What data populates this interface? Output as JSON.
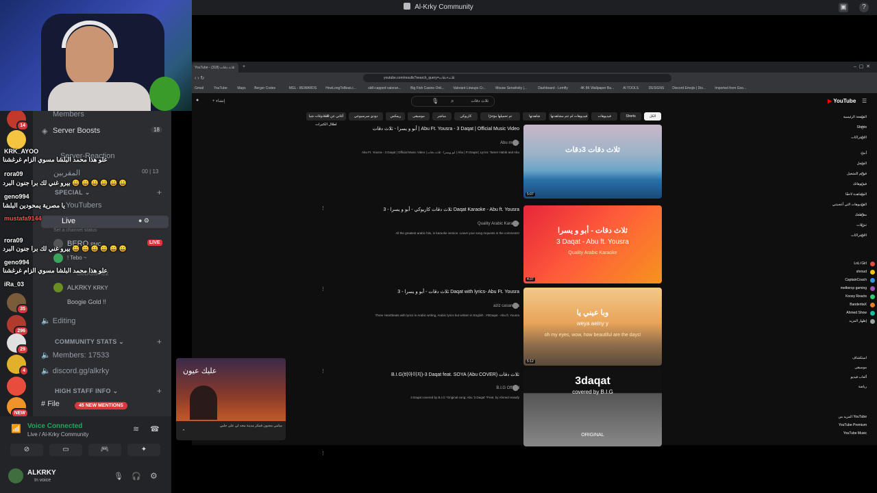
{
  "app": {
    "title": "Al-Krky Community"
  },
  "rail": {
    "servers": [
      {
        "badge": "14",
        "color": "#c0392b"
      },
      {
        "badge": "",
        "color": "#f5c542"
      },
      {
        "badge": "35",
        "color": "#7a5c3a"
      },
      {
        "badge": "296",
        "color": "#b03a2e"
      },
      {
        "badge": "29",
        "color": "#e0e0e0"
      },
      {
        "badge": "4",
        "color": "#e1b12c"
      },
      {
        "badge": "",
        "color": "#e74c3c"
      },
      {
        "badge": "NEW",
        "color": "#f0932b"
      }
    ]
  },
  "sidebar": {
    "members": "Members",
    "server_boosts": "Server Boosts",
    "boost_count": "18",
    "server_reaction": "Server-Reaction",
    "category_muted_label": "المقربين",
    "muted_count_a": "00",
    "muted_count_b": "13",
    "special_category": "SPECIAL",
    "youtubers": "YouTubers",
    "live_channel": "Live",
    "channel_status_placeholder": "Set a channel status",
    "voice_user_1": "BERO",
    "voice_user_1_tag": "PMC",
    "live_badge": "LIVE",
    "voice_user_2": "! Tebo ~",
    "voice_user_3": "SeDGamez",
    "voice_user_4": "ALKRKY",
    "voice_user_4_tag": "KRKY",
    "voice_user_5": "Boogie Gold !!",
    "editing": "Editing",
    "community_stats": "COMMUNITY STATS",
    "members_count": "Members: 17533",
    "invite": "discord.gg/alkrky",
    "high_staff": "HIGH STAFF INFO",
    "files": "File",
    "new_mentions": "45 NEW MENTIONS"
  },
  "chat_overlay": [
    {
      "user": "KRK_AYOO",
      "text": "علو هذا محمد البلشا مسوي الزام غرغشنا"
    },
    {
      "user": "rora09",
      "text": "بيرو غني لك برا جنون البرد 😀 😀 😀 😀 😀 😀"
    },
    {
      "user": "geno994",
      "text": "يا مصرية يمحودين البلشا"
    },
    {
      "user": "mustafa9144",
      "text": ""
    },
    {
      "user": "rora09",
      "text": "بيرو غني لك برا جنون البرد 😀 😀 😀 😀 😀 😀"
    },
    {
      "user": "geno994",
      "text": "علو هذا محمد البلشا مسوي الزام غرغشنا"
    },
    {
      "user": "iRa_03",
      "text": ""
    }
  ],
  "voice": {
    "status": "Voice Connected",
    "channel": "Live / Al-Krky Community"
  },
  "user": {
    "name": "ALKRKY",
    "status": "In voice"
  },
  "browser": {
    "tab_title": "YouTube - ثلاث دقات (318)",
    "url": "youtube.com/results?search_query=ثلاث+دقات",
    "bookmarks": [
      "Gmail",
      "YouTube",
      "Maps",
      "Berger Codes",
      "MGL - REWARDS",
      "HowLongToBeat.c...",
      "skill-capped valoran...",
      "Big Fish Casino Onli...",
      "Valorant Lineups Cr...",
      "Mouse Sensitivity |...",
      "Dashboard - Lemfly",
      "4K 8K Wallpaper Ba...",
      "AI TOOLS",
      "DESIGNS",
      "Discord Emojis | Dis...",
      "Imported from Goo..."
    ],
    "search_query": "ثلاث دقات",
    "chips": [
      "الكل",
      "Shorts",
      "فيديوهات",
      "فيديوهات لم تتم مشاهدتها",
      "شاهدتها",
      "تم تحميلها مؤخرًا",
      "كاريوكي",
      "مباشر",
      "موسيقى",
      "ريمكس",
      "دودي سرسيوعي",
      "أغاني عن ثلاث دقات شيا لطلال الكثيرات"
    ],
    "filter": "الفلاتر",
    "results": [
      {
        "title": "أبو و يسرا - ثلاث دقات | Abu Ft. Yousra - 3 Daqat | Official Music Video",
        "channel": "Abu music",
        "desc": "Abu Ft. Yousra - 3 Daqat | Official Music Video | أبو ويسرا - ثلاث دقات | Abu | Ft Daqat | Lyrics: Tamer Habib and Abu",
        "duration": "5:07",
        "thumb_text": "ثلاث دقات 3دقات"
      },
      {
        "title": "ثلاث دقات كاريوكي - أبو و يسرا - 3 Daqat Karaoke - Abu ft. Yousra",
        "channel": "Quality Arabic Karaoke",
        "desc": "All the greatest arabic hits, in karaoke version. Leave your song requests in the comments!",
        "duration": "4:37",
        "thumb_text": "ثلاث دقات - أبو و يسرا",
        "thumb_sub": "3 Daqat - Abu ft. Yousra",
        "thumb_sub2": "Quality Arabic Karaoke"
      },
      {
        "title": "ثلاث دقات - أبو و يسرا - 3 Daqat with lyrics- Abu Ft. Yousra",
        "channel": "aziz casanova",
        "desc": "Three Heartbeats with lyrics in Arabic writing, Arabic lyrics but written in English : #3Daqat - Abu ft. Yousra",
        "duration": "5:12",
        "thumb_text": "وبا عيني يا",
        "thumb_sub": "weya aeiny y",
        "thumb_sub2": "oh my eyes, wow, how beautiful are the days!"
      },
      {
        "title": "B.I.G(비아이지)-3 Daqat feat. SOYA (Abu COVER) ثلاث دقات",
        "channel": "B.I.G Official",
        "desc": "3 Daqat covered by B.I.G *Original song: Abu '3 Daqat' *Feat. by Ahmed Hasafy",
        "duration": "",
        "thumb_text": "3daqat",
        "thumb_sub": "covered by B.I.G",
        "thumb_sub2": "ORIGINAL"
      }
    ],
    "yt_logo": "YouTube",
    "side_nav": [
      "الصفحة الرئيسية",
      "Shorts",
      "الاشتراكات",
      "أنت",
      "السجل",
      "قوائم التشغيل",
      "فيديوهاتك",
      "المشاهدة لاحقًا",
      "الفيديوهات التي أعجبتني",
      "مقاطعك",
      "تنزيلات",
      "الاشتراكات"
    ],
    "subs": [
      "LoLi Girl",
      "shroud",
      "CaptainCoach",
      "melkercp gaming",
      "Koosy Reacts",
      "BanderitaX",
      "Ahmed Show",
      "إظهار المزيد"
    ],
    "explore": [
      "استكشاف",
      "موسيقى",
      "ألعاب فيديو",
      "رياضة"
    ],
    "more_from": [
      "المزيد من YouTube",
      "YouTube Premium",
      "YouTube Music"
    ],
    "pip_title": "عليك عيون",
    "pip_caption": "ميامي مجنون فمكر مدينة محد لي على جلبي"
  }
}
